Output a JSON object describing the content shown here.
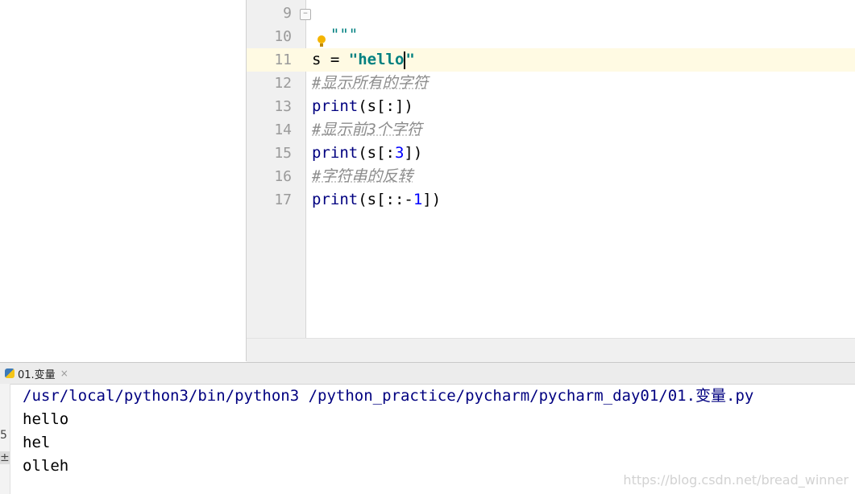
{
  "editor": {
    "line_numbers": [
      "9",
      "10",
      "11",
      "12",
      "13",
      "14",
      "15",
      "16",
      "17"
    ],
    "lines": {
      "l9": "\"\"\"",
      "l11_var": "s = ",
      "l11_str": "\"hello",
      "l11_end": "\"",
      "l12": "#显示所有的字符",
      "l13_fn": "print",
      "l13_rest": "(s[:])",
      "l14": "#显示前3个字符",
      "l15_fn": "print",
      "l15_a": "(s[:",
      "l15_num": "3",
      "l15_b": "])",
      "l16": "#字符串的反转",
      "l17_fn": "print",
      "l17_a": "(s[::-",
      "l17_num": "1",
      "l17_b": "])"
    }
  },
  "run": {
    "tab_label": "01.变量",
    "tab_close": "×",
    "strip_marks": [
      "5",
      "±"
    ],
    "output": [
      "/usr/local/python3/bin/python3 /python_practice/pycharm/pycharm_day01/01.变量.py",
      "hello",
      "hel",
      "olleh"
    ]
  },
  "watermark": "https://blog.csdn.net/bread_winner"
}
